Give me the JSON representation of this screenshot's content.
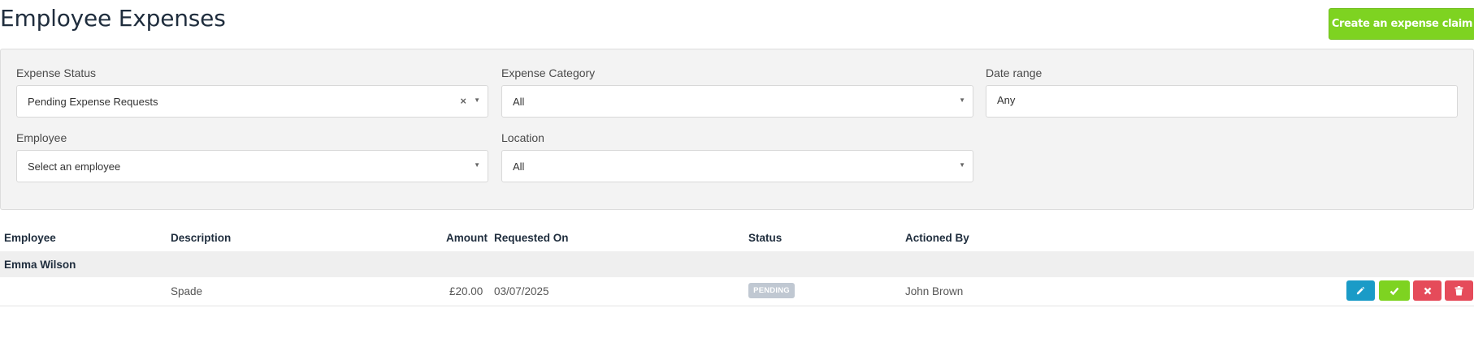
{
  "page": {
    "title": "Employee Expenses"
  },
  "toolbar": {
    "create_label": "Create an expense claim"
  },
  "filters": {
    "expense_status": {
      "label": "Expense Status",
      "value": "Pending Expense Requests"
    },
    "expense_category": {
      "label": "Expense Category",
      "value": "All"
    },
    "date_range": {
      "label": "Date range",
      "value": "Any"
    },
    "employee": {
      "label": "Employee",
      "value": "Select an employee"
    },
    "location": {
      "label": "Location",
      "value": "All"
    }
  },
  "table": {
    "columns": [
      "Employee",
      "Description",
      "Amount",
      "Requested On",
      "Status",
      "Actioned By"
    ],
    "groups": [
      {
        "name": "Emma Wilson",
        "rows": [
          {
            "description": "Spade",
            "amount": "£20.00",
            "requested_on": "03/07/2025",
            "status": "PENDING",
            "actioned_by": "John Brown"
          }
        ]
      }
    ]
  },
  "actions": {
    "icons": [
      "pencil-icon",
      "check-icon",
      "close-icon",
      "trash-icon"
    ],
    "colors": {
      "edit": "#1a9bc7",
      "approve": "#7ed321",
      "reject": "#e54b5a",
      "delete": "#e54b5a"
    }
  },
  "colors": {
    "accent": "#7ed321",
    "title": "#1f2d3d",
    "badge": "#c0c8d2"
  }
}
